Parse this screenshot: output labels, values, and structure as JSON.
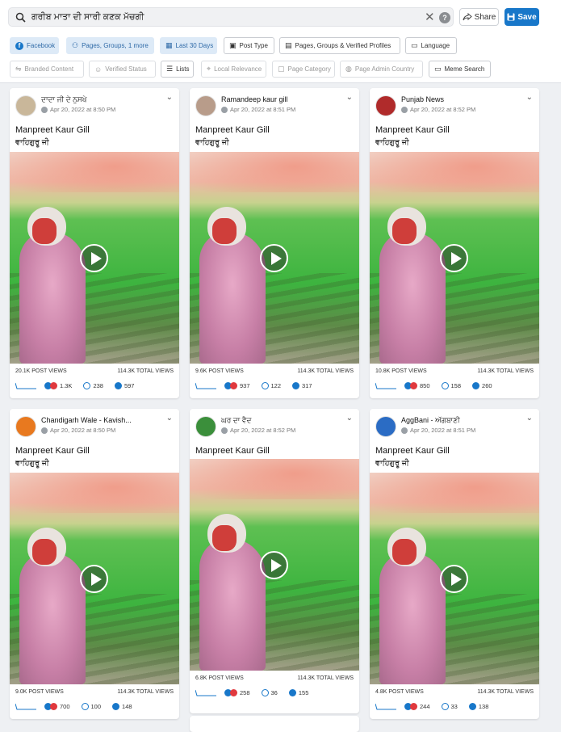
{
  "search": {
    "query": "ਗਰੀਬ ਮਾਤਾ ਦੀ ਸਾਰੀ ਕਣਕ ਮੱਚਗੀ"
  },
  "toolbar": {
    "share_label": "Share",
    "save_label": "Save"
  },
  "filters_row1": [
    {
      "label": "Facebook",
      "icon": "facebook-icon",
      "state": "active"
    },
    {
      "label": "Pages, Groups, 1 more",
      "icon": "people-icon",
      "state": "active"
    },
    {
      "label": "Last 30 Days",
      "icon": "calendar-icon",
      "state": "active"
    },
    {
      "label": "Post Type",
      "icon": "post-type-icon",
      "state": "plain"
    },
    {
      "label": "Pages, Groups & Verified Profiles",
      "icon": "list-icon",
      "state": "plain"
    },
    {
      "label": "Language",
      "icon": "language-icon",
      "state": "plain"
    }
  ],
  "filters_row2": [
    {
      "label": "Branded Content",
      "icon": "handshake-icon",
      "state": "dim"
    },
    {
      "label": "Verified Status",
      "icon": "verified-user-icon",
      "state": "dim"
    },
    {
      "label": "Lists",
      "icon": "lists-icon",
      "state": "plain"
    },
    {
      "label": "Local Relevance",
      "icon": "location-pin-icon",
      "state": "dim"
    },
    {
      "label": "Page Category",
      "icon": "category-icon",
      "state": "dim"
    },
    {
      "label": "Page Admin Country",
      "icon": "globe-icon",
      "state": "dim"
    },
    {
      "label": "Meme Search",
      "icon": "speech-bubble-icon",
      "state": "plain"
    }
  ],
  "posts": [
    {
      "name": "ਦਾਦਾ ਜੀ ਦੇ ਨੁਸਖੇ",
      "date": "Apr 20, 2022 at 8:50 PM",
      "title": "Manpreet Kaur Gill",
      "message": "ਵਾਹਿਗੁਰੂ ਜੀ",
      "post_views": "20.1K POST VIEWS",
      "total_views": "114.3K TOTAL VIEWS",
      "reactions": "1.3K",
      "comments": "238",
      "shares": "597",
      "avatar_color": "#c9b79a"
    },
    {
      "name": "Ramandeep kaur gill",
      "date": "Apr 20, 2022 at 8:51 PM",
      "title": "Manpreet Kaur Gill",
      "message": "ਵਾਹਿਗੁਰੂ ਜੀ",
      "post_views": "9.6K POST VIEWS",
      "total_views": "114.3K TOTAL VIEWS",
      "reactions": "937",
      "comments": "122",
      "shares": "317",
      "avatar_color": "#b89c8a"
    },
    {
      "name": "Punjab News",
      "date": "Apr 20, 2022 at 8:52 PM",
      "title": "Manpreet Kaur Gill",
      "message": "ਵਾਹਿਗੁਰੂ ਜੀ",
      "post_views": "10.8K POST VIEWS",
      "total_views": "114.3K TOTAL VIEWS",
      "reactions": "850",
      "comments": "158",
      "shares": "260",
      "avatar_color": "#b02b2b"
    },
    {
      "name": "Chandigarh Wale - Kavish...",
      "date": "Apr 20, 2022 at 8:50 PM",
      "title": "Manpreet Kaur Gill",
      "message": "ਵਾਹਿਗੁਰੂ ਜੀ",
      "post_views": "9.0K POST VIEWS",
      "total_views": "114.3K TOTAL VIEWS",
      "reactions": "700",
      "comments": "100",
      "shares": "148",
      "avatar_color": "#e8791f"
    },
    {
      "name": "ਘਰ ਦਾ ਵੈਦ",
      "date": "Apr 20, 2022 at 8:52 PM",
      "title": "Manpreet Kaur Gill",
      "message": "",
      "post_views": "6.8K POST VIEWS",
      "total_views": "114.3K TOTAL VIEWS",
      "reactions": "258",
      "comments": "36",
      "shares": "155",
      "avatar_color": "#3b8f3b"
    },
    {
      "name": "AggBani - ਅੱਗਬਾਣੀ",
      "date": "Apr 20, 2022 at 8:51 PM",
      "title": "Manpreet Kaur Gill",
      "message": "ਵਾਹਿਗੁਰੂ ਜੀ",
      "post_views": "4.8K POST VIEWS",
      "total_views": "114.3K TOTAL VIEWS",
      "reactions": "244",
      "comments": "33",
      "shares": "138",
      "avatar_color": "#2b6cc4"
    }
  ],
  "colors": {
    "accent": "#1877c9",
    "active_chip_bg": "#ddeaf7",
    "active_chip_text": "#2f6aa7",
    "page_bg": "#eef0f3"
  }
}
